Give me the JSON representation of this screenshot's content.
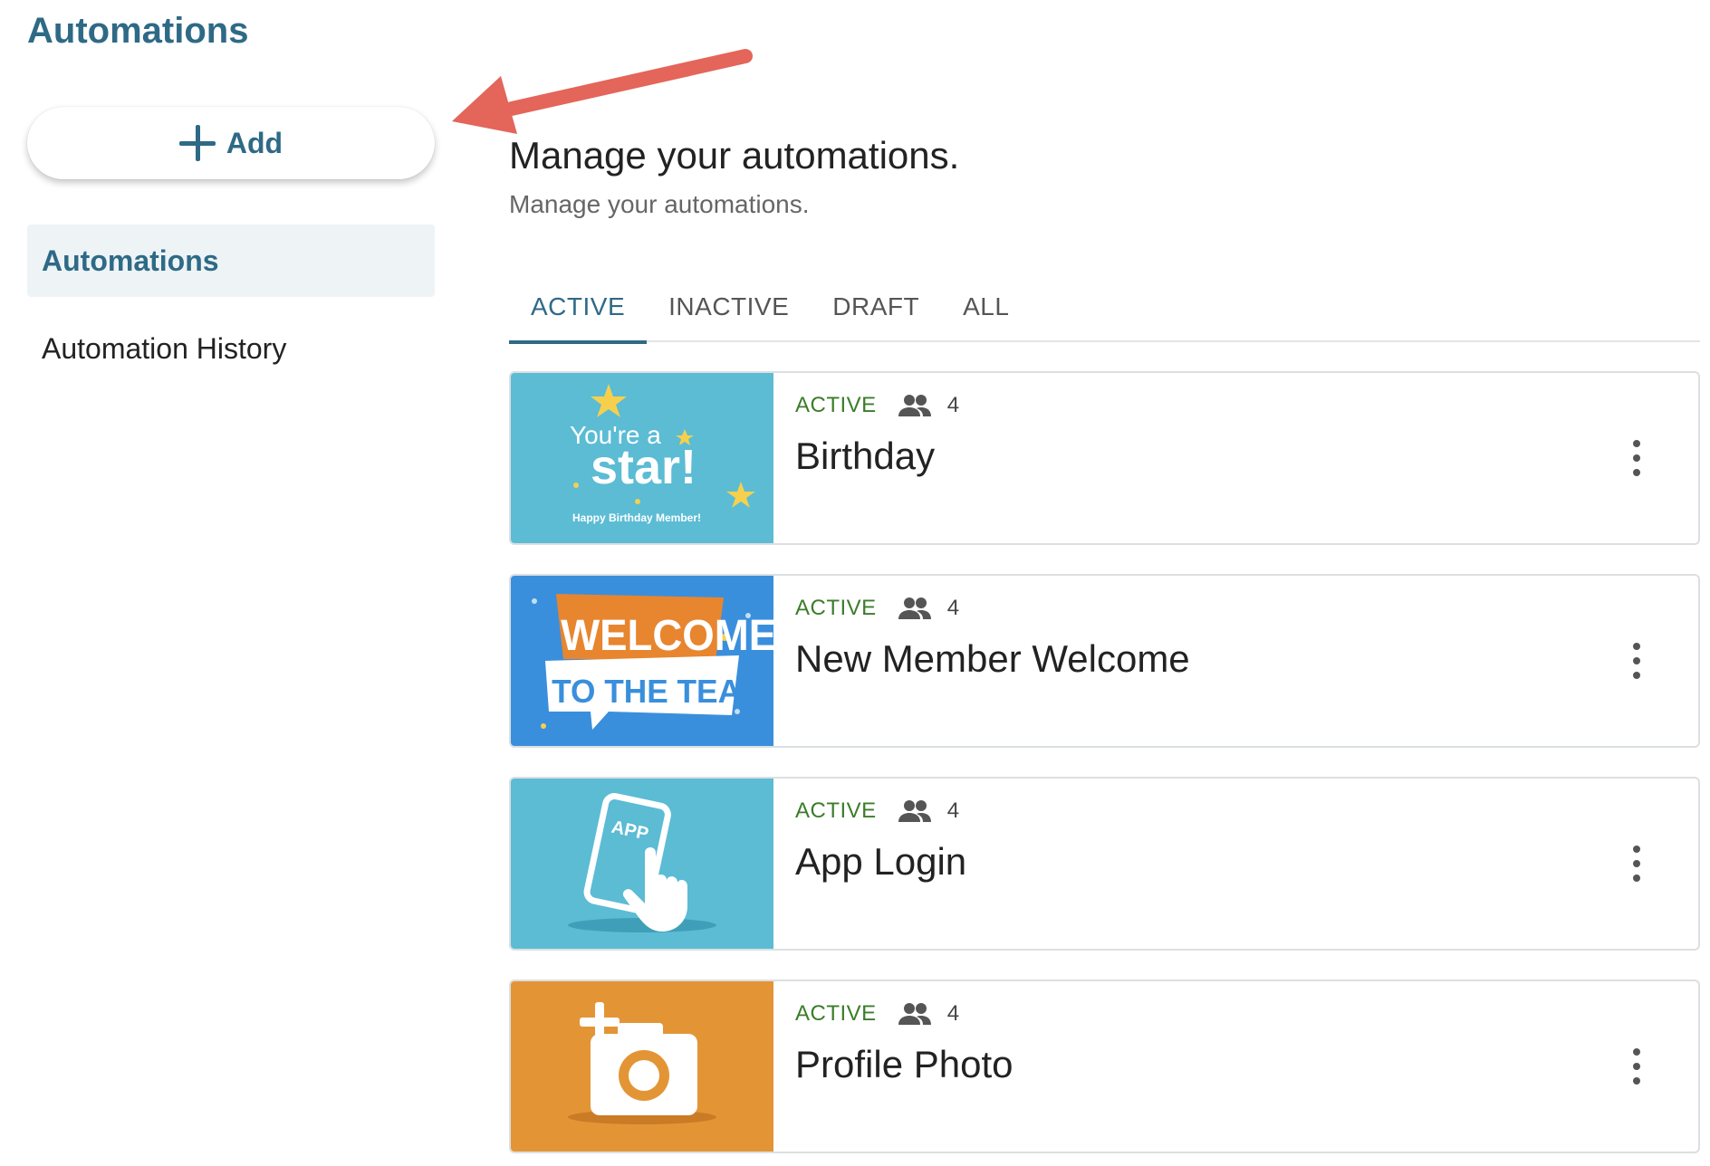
{
  "page": {
    "title": "Automations"
  },
  "sidebar": {
    "add_label": "Add",
    "items": [
      {
        "label": "Automations",
        "active": true
      },
      {
        "label": "Automation History",
        "active": false
      }
    ]
  },
  "main": {
    "heading": "Manage your automations.",
    "subheading": "Manage your automations.",
    "tabs": [
      {
        "label": "ACTIVE",
        "active": true
      },
      {
        "label": "INACTIVE",
        "active": false
      },
      {
        "label": "DRAFT",
        "active": false
      },
      {
        "label": "ALL",
        "active": false
      }
    ],
    "automations": [
      {
        "title": "Birthday",
        "status": "ACTIVE",
        "count": "4",
        "thumb": {
          "bg": "#5bbcd4",
          "line1": "You're a",
          "line2": "star!",
          "line3": "Happy Birthday Member!"
        }
      },
      {
        "title": "New Member Welcome",
        "status": "ACTIVE",
        "count": "4",
        "thumb": {
          "bg": "#3a8fdc",
          "line1": "WELCOME",
          "line2": "TO THE TEAM!"
        }
      },
      {
        "title": "App Login",
        "status": "ACTIVE",
        "count": "4",
        "thumb": {
          "bg": "#5bbcd4",
          "line1": "APP"
        }
      },
      {
        "title": "Profile Photo",
        "status": "ACTIVE",
        "count": "4",
        "thumb": {
          "bg": "#e39536"
        }
      }
    ]
  },
  "colors": {
    "accent": "#2e6a86",
    "status_active": "#3b7d2a",
    "arrow": "#e4655a"
  },
  "icons": [
    "plus-icon",
    "people-icon",
    "kebab-menu-icon",
    "annotation-arrow-icon"
  ]
}
